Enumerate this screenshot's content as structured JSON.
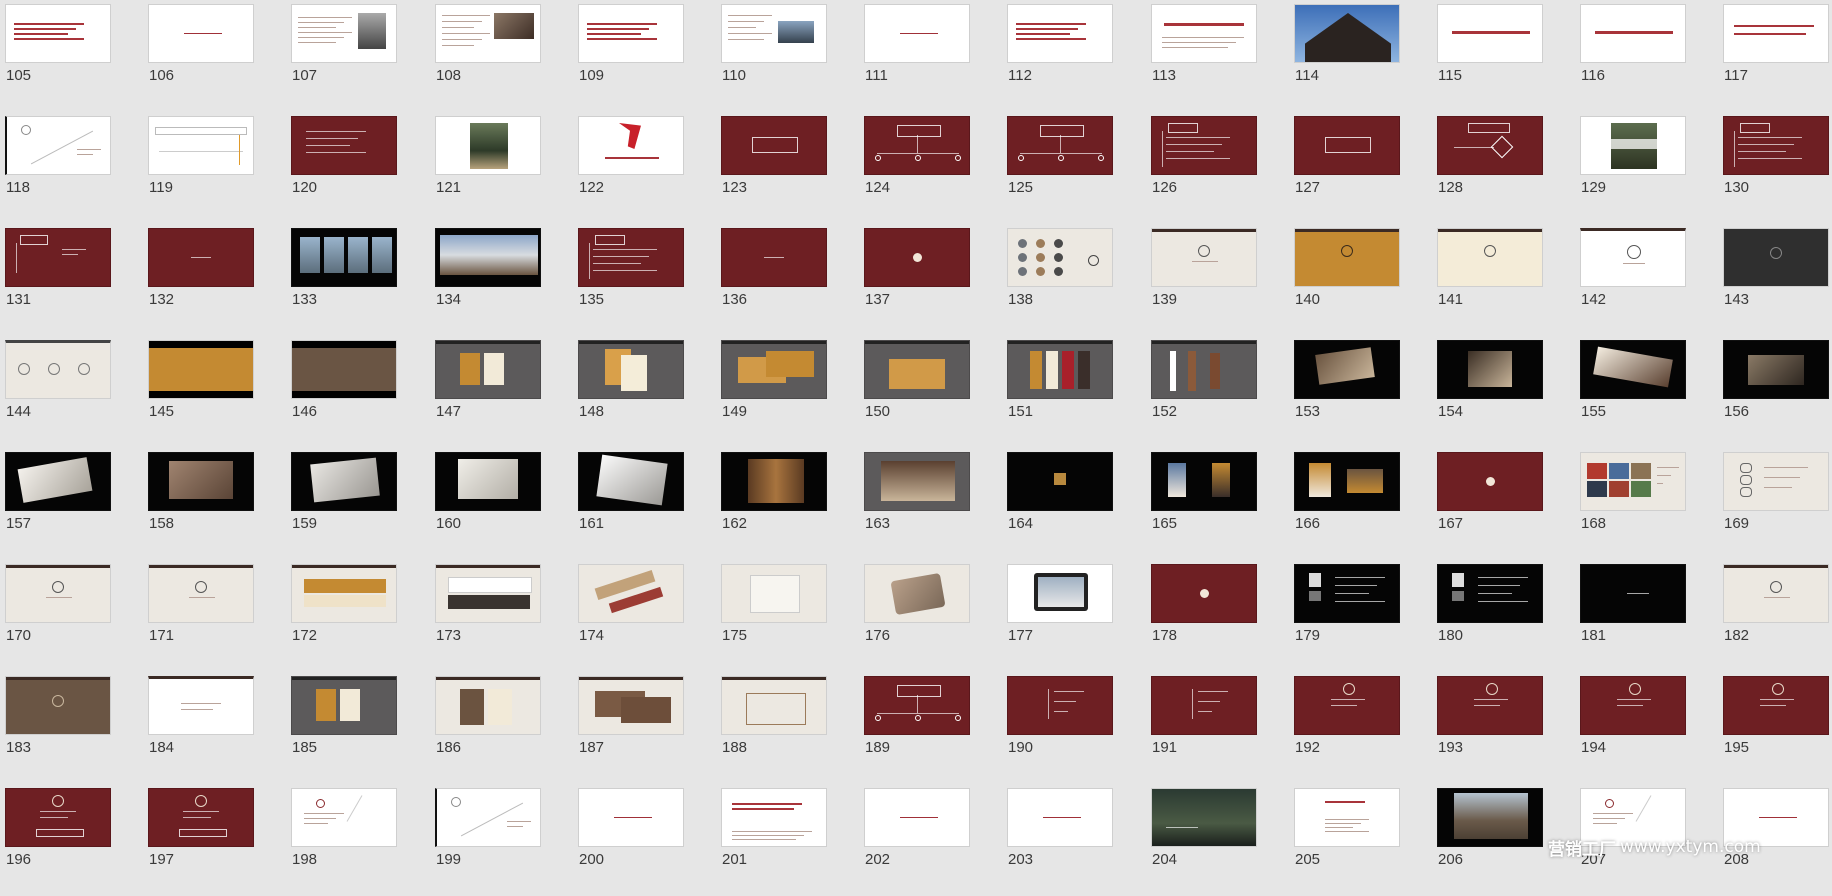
{
  "slides": [
    {
      "n": "105",
      "s": "white-text"
    },
    {
      "n": "106",
      "s": "white-center"
    },
    {
      "n": "107",
      "s": "white-photo"
    },
    {
      "n": "108",
      "s": "white-photo2"
    },
    {
      "n": "109",
      "s": "white-text"
    },
    {
      "n": "110",
      "s": "white-photo3"
    },
    {
      "n": "111",
      "s": "white-center"
    },
    {
      "n": "112",
      "s": "white-text"
    },
    {
      "n": "113",
      "s": "white-title"
    },
    {
      "n": "114",
      "s": "roof"
    },
    {
      "n": "115",
      "s": "white-red"
    },
    {
      "n": "116",
      "s": "white-red"
    },
    {
      "n": "117",
      "s": "white-red2"
    },
    {
      "n": "118",
      "s": "white-diag"
    },
    {
      "n": "119",
      "s": "white-chart"
    },
    {
      "n": "120",
      "s": "red-text"
    },
    {
      "n": "121",
      "s": "white-land"
    },
    {
      "n": "122",
      "s": "white-logo"
    },
    {
      "n": "123",
      "s": "red-box"
    },
    {
      "n": "124",
      "s": "red-tree"
    },
    {
      "n": "125",
      "s": "red-tree"
    },
    {
      "n": "126",
      "s": "red-list"
    },
    {
      "n": "127",
      "s": "red-box"
    },
    {
      "n": "128",
      "s": "red-tree2"
    },
    {
      "n": "129",
      "s": "white-land2"
    },
    {
      "n": "130",
      "s": "red-list"
    },
    {
      "n": "131",
      "s": "red-list2"
    },
    {
      "n": "132",
      "s": "red-plain"
    },
    {
      "n": "133",
      "s": "black-window"
    },
    {
      "n": "134",
      "s": "black-scene"
    },
    {
      "n": "135",
      "s": "red-list"
    },
    {
      "n": "136",
      "s": "red-plain"
    },
    {
      "n": "137",
      "s": "red-emblem"
    },
    {
      "n": "138",
      "s": "cream-icons"
    },
    {
      "n": "139",
      "s": "cream-logo"
    },
    {
      "n": "140",
      "s": "gold-logo"
    },
    {
      "n": "141",
      "s": "ivory-logo"
    },
    {
      "n": "142",
      "s": "white-logo2"
    },
    {
      "n": "143",
      "s": "dark-logo"
    },
    {
      "n": "144",
      "s": "cream-logos"
    },
    {
      "n": "145",
      "s": "gold-band"
    },
    {
      "n": "146",
      "s": "brown-band"
    },
    {
      "n": "147",
      "s": "gray-cards"
    },
    {
      "n": "148",
      "s": "gray-cards2"
    },
    {
      "n": "149",
      "s": "gray-env"
    },
    {
      "n": "150",
      "s": "gray-bag"
    },
    {
      "n": "151",
      "s": "gray-tags"
    },
    {
      "n": "152",
      "s": "gray-bars"
    },
    {
      "n": "153",
      "s": "black-prod"
    },
    {
      "n": "154",
      "s": "black-prod2"
    },
    {
      "n": "155",
      "s": "black-prod3"
    },
    {
      "n": "156",
      "s": "black-prod4"
    },
    {
      "n": "157",
      "s": "black-book"
    },
    {
      "n": "158",
      "s": "black-book2"
    },
    {
      "n": "159",
      "s": "black-paper"
    },
    {
      "n": "160",
      "s": "black-paper2"
    },
    {
      "n": "161",
      "s": "black-paper3"
    },
    {
      "n": "162",
      "s": "black-shelf"
    },
    {
      "n": "163",
      "s": "gray-room"
    },
    {
      "n": "164",
      "s": "black-badge"
    },
    {
      "n": "165",
      "s": "black-flags"
    },
    {
      "n": "166",
      "s": "black-flags2"
    },
    {
      "n": "167",
      "s": "red-emblem"
    },
    {
      "n": "168",
      "s": "cream-collage"
    },
    {
      "n": "169",
      "s": "cream-icons2"
    },
    {
      "n": "170",
      "s": "cream-logo"
    },
    {
      "n": "171",
      "s": "cream-logo"
    },
    {
      "n": "172",
      "s": "cream-gold"
    },
    {
      "n": "173",
      "s": "cream-dark"
    },
    {
      "n": "174",
      "s": "cream-stat"
    },
    {
      "n": "175",
      "s": "cream-doc"
    },
    {
      "n": "176",
      "s": "cream-roll"
    },
    {
      "n": "177",
      "s": "white-tablet"
    },
    {
      "n": "178",
      "s": "red-emblem"
    },
    {
      "n": "179",
      "s": "black-menu"
    },
    {
      "n": "180",
      "s": "black-menu"
    },
    {
      "n": "181",
      "s": "black-logo"
    },
    {
      "n": "182",
      "s": "cream-logo"
    },
    {
      "n": "183",
      "s": "brown-logo"
    },
    {
      "n": "184",
      "s": "white-logo3"
    },
    {
      "n": "185",
      "s": "gray-cards"
    },
    {
      "n": "186",
      "s": "cream-cards"
    },
    {
      "n": "187",
      "s": "cream-env"
    },
    {
      "n": "188",
      "s": "cream-bag"
    },
    {
      "n": "189",
      "s": "red-tree"
    },
    {
      "n": "190",
      "s": "red-tree3"
    },
    {
      "n": "191",
      "s": "red-tree3"
    },
    {
      "n": "192",
      "s": "red-seal"
    },
    {
      "n": "193",
      "s": "red-seal"
    },
    {
      "n": "194",
      "s": "red-seal"
    },
    {
      "n": "195",
      "s": "red-seal"
    },
    {
      "n": "196",
      "s": "red-seal2"
    },
    {
      "n": "197",
      "s": "red-seal2"
    },
    {
      "n": "198",
      "s": "white-text2"
    },
    {
      "n": "199",
      "s": "white-diag"
    },
    {
      "n": "200",
      "s": "white-center"
    },
    {
      "n": "201",
      "s": "white-text3"
    },
    {
      "n": "202",
      "s": "white-center"
    },
    {
      "n": "203",
      "s": "white-center"
    },
    {
      "n": "204",
      "s": "dark-land"
    },
    {
      "n": "205",
      "s": "white-text4"
    },
    {
      "n": "206",
      "s": "black-house"
    },
    {
      "n": "207",
      "s": "white-text2"
    },
    {
      "n": "208",
      "s": "white-center"
    }
  ],
  "watermark": {
    "brand": "营销工厂",
    "url": "www.yxtym.com"
  }
}
